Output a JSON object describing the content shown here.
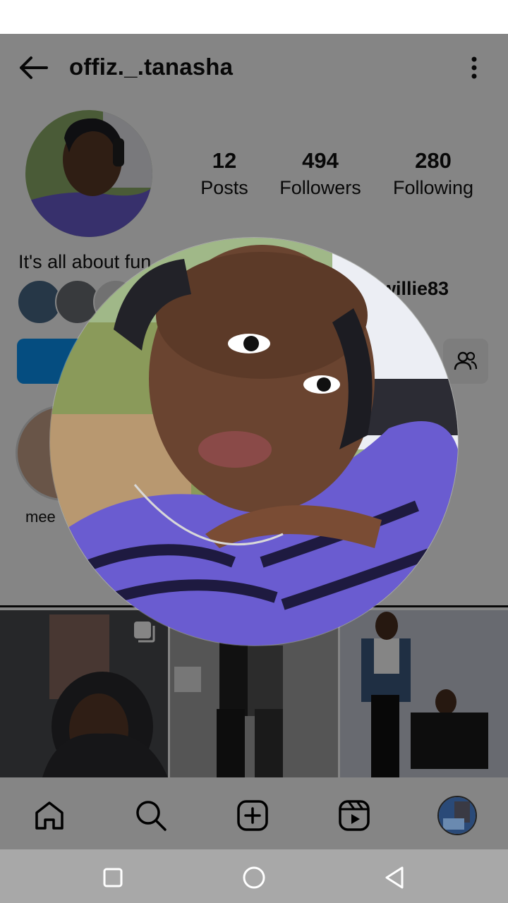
{
  "header": {
    "username": "offiz._.tanasha"
  },
  "stats": {
    "posts": {
      "value": "12",
      "label": "Posts"
    },
    "followers": {
      "value": "494",
      "label": "Followers"
    },
    "following": {
      "value": "280",
      "label": "Following"
    }
  },
  "bio": {
    "text": "It's all about fun"
  },
  "mutual": {
    "text": "willie83"
  },
  "highlights": [
    {
      "label": "mee"
    }
  ],
  "bottom_nav": {
    "items": [
      "home-icon",
      "search-icon",
      "create-icon",
      "reels-icon",
      "profile-avatar"
    ]
  },
  "system_nav": {
    "items": [
      "recent-apps-icon",
      "home-circle-icon",
      "back-triangle-icon"
    ]
  },
  "colors": {
    "follow_button": "#0b95f6",
    "overlay": "rgba(0,0,0,0.48)",
    "shirt_purple": "#6a5cd0",
    "system_nav": "#a8a8a8"
  }
}
